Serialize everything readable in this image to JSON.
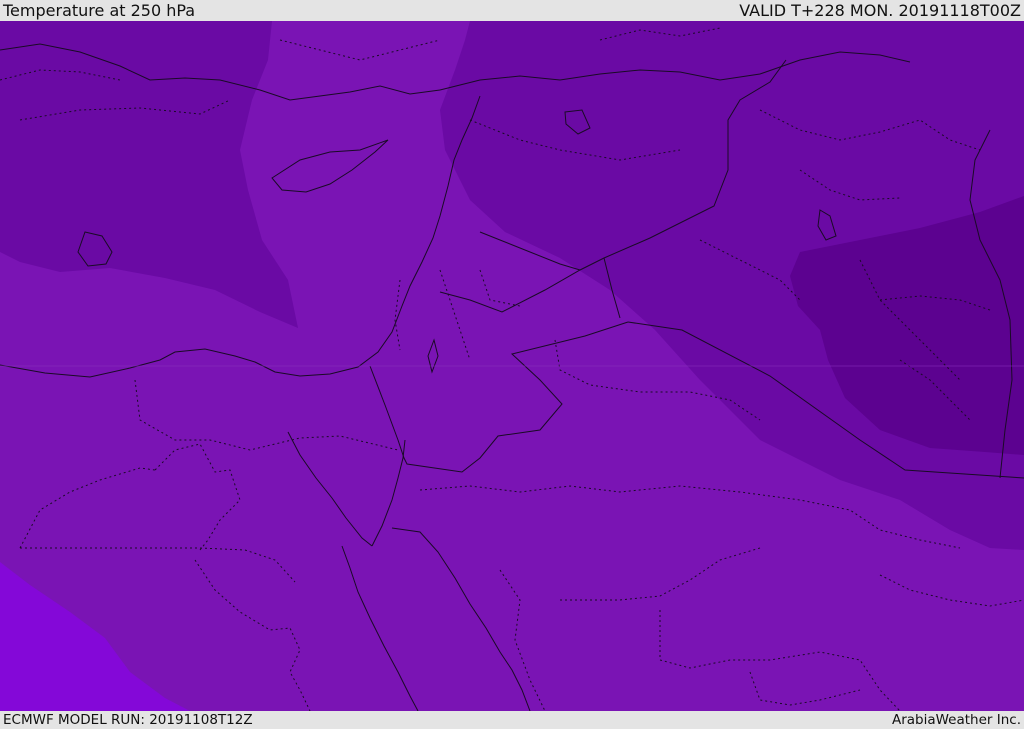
{
  "header": {
    "title": "Temperature at 250 hPa",
    "valid": "VALID T+228 MON. 20191118T00Z"
  },
  "footer": {
    "model_run": "ECMWF MODEL RUN: 20191108T12Z",
    "credit": "ArabiaWeather Inc."
  },
  "map": {
    "colors": {
      "base": "#7a14b4",
      "cold": "#6a0aa4",
      "colder": "#5c0290",
      "warm": "#8408d8",
      "border": "#1a0a26"
    }
  }
}
